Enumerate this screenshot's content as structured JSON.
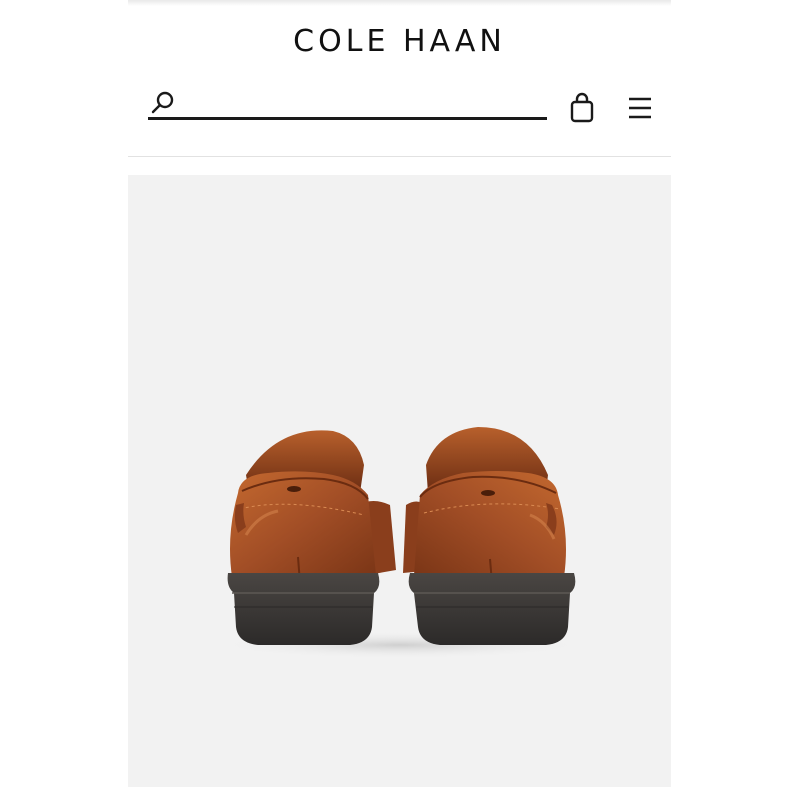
{
  "header": {
    "brand": "COLE HAAN",
    "search": {
      "value": "",
      "placeholder": ""
    },
    "icons": {
      "search": "search-icon",
      "bag": "shopping-bag-icon",
      "menu": "hamburger-menu-icon"
    }
  },
  "product": {
    "image": "brown-leather-loafers-rear-view"
  },
  "colors": {
    "text": "#111111",
    "image_background": "#f2f2f2",
    "leather": "#a24e26",
    "sole": "#3d3a38"
  }
}
